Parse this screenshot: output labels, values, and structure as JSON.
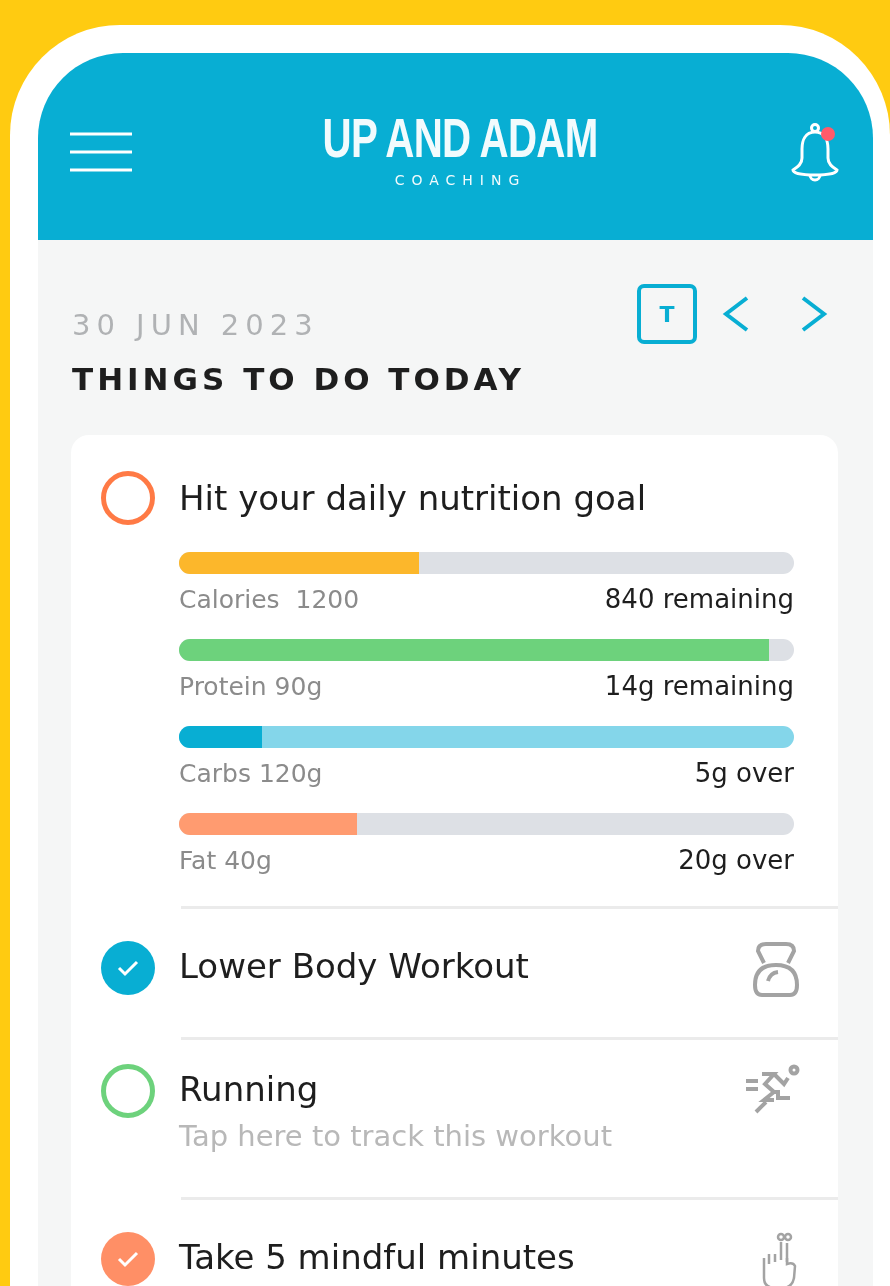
{
  "header": {
    "brand": "UP AND ADAM",
    "tagline": "COACHING",
    "notification": true
  },
  "date": "30 JUN 2023",
  "heading": "THINGS TO DO TODAY",
  "today_button": "T",
  "nutrition": {
    "title": "Hit your daily nutrition goal",
    "done": false,
    "color": "#ff7a45",
    "macros": [
      {
        "label": "Calories  1200",
        "reading": "840 remaining",
        "level": 0.39,
        "color": "#fcb72b",
        "tinted_track": false
      },
      {
        "label": "Protein 90g",
        "reading": "14g remaining",
        "level": 0.96,
        "color": "#6dd27c",
        "tinted_track": false
      },
      {
        "label": "Carbs 120g",
        "reading": "5g over",
        "level": 0.135,
        "color": "#08aed3",
        "tinted_track": true
      },
      {
        "label": "Fat 40g",
        "reading": "20g over",
        "level": 0.29,
        "color": "#ff9b70",
        "tinted_track": false
      }
    ]
  },
  "tasks": [
    {
      "title": "Lower Body Workout",
      "done": true,
      "color": "#08aed3",
      "kind": "kettlebell"
    },
    {
      "title": "Running",
      "subtitle": "Tap here to track this workout",
      "done": false,
      "color": "#6dd27c",
      "kind": "running"
    },
    {
      "title": "Take 5 mindful minutes",
      "done": true,
      "color": "#ff8f66",
      "kind": "reminder"
    }
  ]
}
